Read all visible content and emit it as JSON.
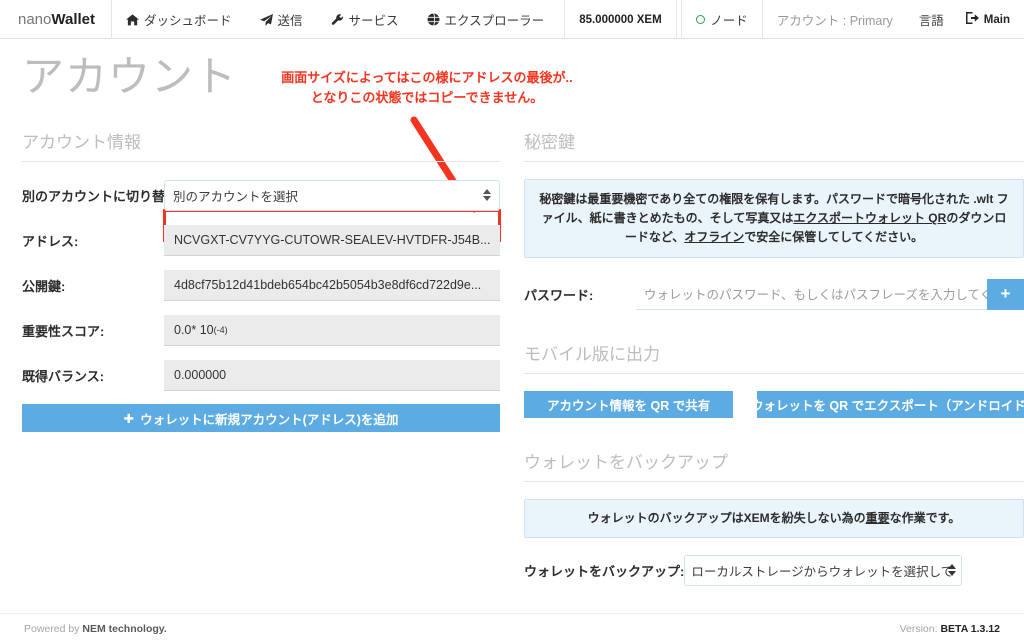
{
  "navbar": {
    "brand_light": "nano",
    "brand_bold": "Wallet",
    "items": [
      {
        "label": "ダッシュボード",
        "icon": "home-icon"
      },
      {
        "label": "送信",
        "icon": "paper-plane-icon"
      },
      {
        "label": "サービス",
        "icon": "wrench-icon"
      },
      {
        "label": "エクスプローラー",
        "icon": "globe-icon"
      }
    ],
    "balance": "85.000000 XEM",
    "node_label": "ノード",
    "node_status_color": "#2f9e44",
    "account_label": "アカウント : Primary",
    "language_label": "言語",
    "main_label": "Main",
    "logout_icon": "sign-out-icon"
  },
  "page": {
    "title": "アカウント"
  },
  "annotation": {
    "line1": "画面サイズによってはこの様にアドレスの最後が..",
    "line2": "となりこの状態ではコピーできません。",
    "color": "#f4341f"
  },
  "left": {
    "section_title": "アカウント情報",
    "switch_account_label": "別のアカウントに切り替える:",
    "switch_account_value": "別のアカウントを選択",
    "address_label": "アドレス:",
    "address_value": "NCVGXT-CV7YYG-CUTOWR-SEALEV-HVTDFR-J54B...",
    "publickey_label": "公開鍵:",
    "publickey_value": "4d8cf75b12d41bdeb654bc42b5054b3e8df6cd722d9e...",
    "importance_label": "重要性スコア:",
    "importance_value": "0.0* 10",
    "importance_exponent": "(-4)",
    "vested_label": "既得バランス:",
    "vested_value": "0.000000",
    "add_account_button": "ウォレットに新規アカウント(アドレス)を追加",
    "add_icon": "plus-icon"
  },
  "right": {
    "privkey_section_title": "秘密鍵",
    "privkey_notice_part1": "秘密鍵は最重要機密であり全ての権限を保有します。パスワードで暗号化された .wlt ファイル、紙に書きとめたもの、そして写真又は",
    "privkey_notice_link1": "エクスポートウォレット QR",
    "privkey_notice_part2": "のダウンロードなど、",
    "privkey_notice_link2": "オフライン",
    "privkey_notice_part3": "で安全に保管してしてください。",
    "password_label": "パスワード:",
    "password_placeholder": "ウォレットのパスワード、もしくはパスフレーズを入力してください",
    "password_add_button": "+",
    "mobile_section_title": "モバイル版に出力",
    "share_qr_button": "アカウント情報を QR で共有",
    "export_qr_button": "ウォレットを QR でエクスポート（アンドロイド）",
    "backup_section_title": "ウォレットをバックアップ",
    "backup_notice_part1": "ウォレットのバックアップはXEMを紛失しない為の",
    "backup_notice_link": "重要",
    "backup_notice_part2": "な作業です。",
    "backup_label": "ウォレットをバックアップ:",
    "backup_select_value": "ローカルストレージからウォレットを選択して"
  },
  "footer": {
    "powered_by": "Powered by",
    "powered_brand": "NEM technology.",
    "version_label": "Version:",
    "version_value": "BETA 1.3.12"
  }
}
